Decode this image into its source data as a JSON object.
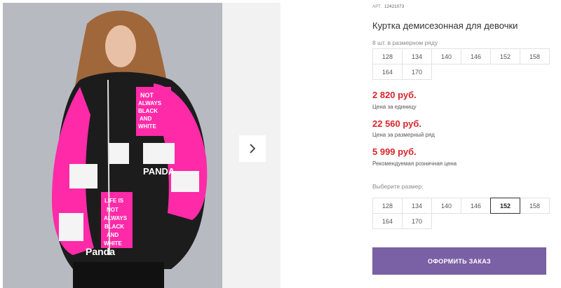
{
  "product": {
    "art_label": "АРТ.",
    "art_value": "12421073",
    "title": "Куртка демисезонная для девочки"
  },
  "pack": {
    "label": "8 шт. в размерном ряду",
    "sizes": [
      "128",
      "134",
      "140",
      "146",
      "152",
      "158",
      "164",
      "170"
    ]
  },
  "prices": [
    {
      "value": "2 820 руб.",
      "caption": "Цена за единицу"
    },
    {
      "value": "22 560 руб.",
      "caption": "Цена за размерный ряд"
    },
    {
      "value": "5 999 руб.",
      "caption": "Рекомендуемая розничная цена"
    }
  ],
  "choose": {
    "label": "Выберите размер:",
    "sizes": [
      "128",
      "134",
      "140",
      "146",
      "152",
      "158",
      "164",
      "170"
    ],
    "selected": "152"
  },
  "order_button": "ОФОРМИТЬ ЗАКАЗ",
  "jacket_print": [
    "NOT",
    "ALWAYS",
    "BLACK",
    "AND",
    "WHITE",
    "LIFE IS",
    "NOT",
    "ALWAYS",
    "BLACK",
    "AND",
    "WHITE",
    "PANDA",
    "Panda"
  ],
  "colors": {
    "accent": "#7a60a4",
    "price": "#d6262b",
    "jacket_pink": "#ff2aa8"
  }
}
